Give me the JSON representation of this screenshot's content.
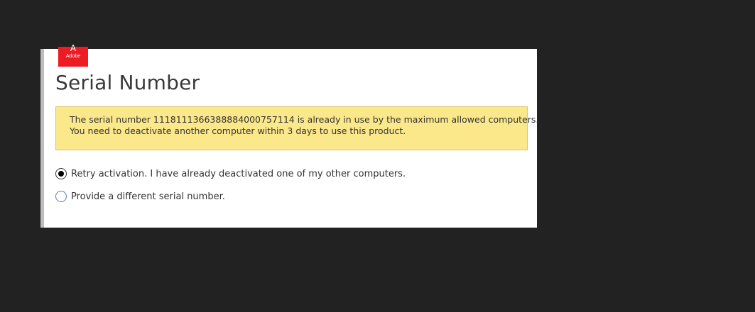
{
  "logo": {
    "mark": "A",
    "text": "Adobe"
  },
  "dialog": {
    "title": "Serial Number",
    "warning": {
      "line1": "The serial number 1118111366388884000757114 is already in use by the maximum allowed computers.",
      "line2": "You need to deactivate another computer within 3 days to use this product."
    },
    "options": [
      {
        "label": "Retry activation. I have already deactivated one of my other computers.",
        "selected": true
      },
      {
        "label": "Provide a different serial number.",
        "selected": false
      }
    ]
  },
  "colors": {
    "background": "#222222",
    "logo": "#ed1c24",
    "warning_bg": "#fbe88a"
  }
}
